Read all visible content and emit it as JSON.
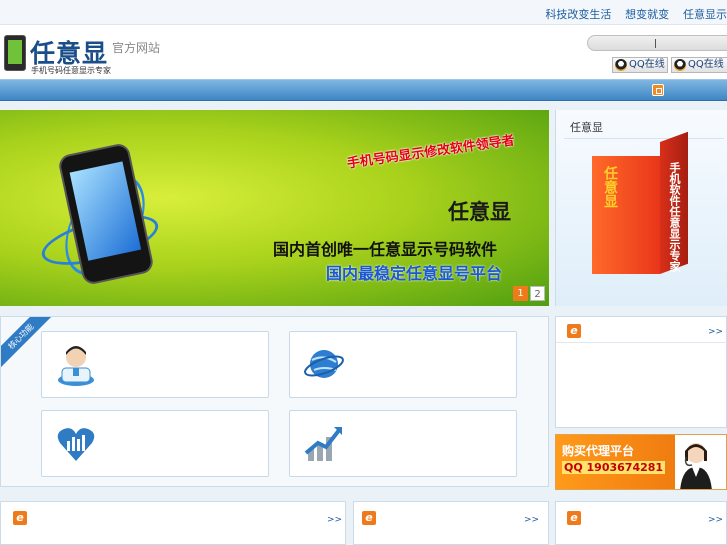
{
  "top_links": [
    "科技改变生活",
    "想变就变",
    "任意显示"
  ],
  "logo": {
    "title": "任意显",
    "subtitle": "官方网站",
    "tagline": "手机号码任意显示专家"
  },
  "qq_buttons": [
    "QQ在线",
    "QQ在线"
  ],
  "banner": {
    "red_text": "手机号码显示修改软件领导者",
    "big_title": "任意显",
    "line1": "国内首创唯一任意显示号码软件",
    "line2": "国内最稳定任意显号平台",
    "pages": [
      "1",
      "2"
    ]
  },
  "product_panel": {
    "title": "任意显",
    "box_front": "任意显",
    "box_side": "手机软件任意显示专家"
  },
  "features": {
    "corner_tag": "核心功能"
  },
  "news_panel": {
    "icon": "e",
    "more": ">>"
  },
  "agent": {
    "title": "购买代理平台",
    "phone": "QQ 1903674281"
  },
  "bottom_panels": [
    {
      "icon": "e",
      "more": ">>"
    },
    {
      "icon": "e",
      "more": ">>"
    },
    {
      "icon": "e",
      "more": ">>"
    }
  ],
  "colors": {
    "brand_blue": "#1a4e8a",
    "nav_blue": "#3e86c4",
    "accent_orange": "#ef7a1b",
    "banner_green": "#a9d21c"
  }
}
